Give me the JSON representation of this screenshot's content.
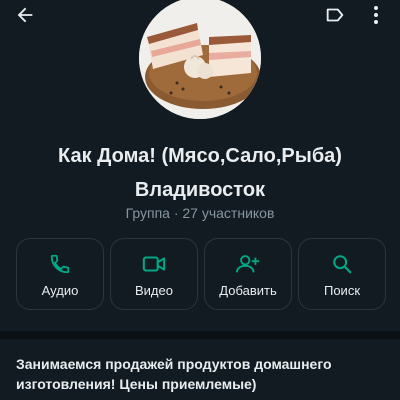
{
  "header": {
    "back_icon": "arrow-left-icon",
    "label_icon": "label-tag-icon",
    "menu_icon": "more-vert-icon"
  },
  "group": {
    "title_line1": "Как Дома! (Мясо,Сало,Рыба)",
    "title_line2": "Владивосток",
    "subtitle": "Группа · 27 участников"
  },
  "actions": [
    {
      "label": "Аудио",
      "icon": "phone-icon"
    },
    {
      "label": "Видео",
      "icon": "video-camera-icon"
    },
    {
      "label": "Добавить",
      "icon": "add-person-icon"
    },
    {
      "label": "Поиск",
      "icon": "search-icon"
    }
  ],
  "description": "Занимаемся продажей продуктов домашнего изготовления! Цены приемлемые)",
  "colors": {
    "background": "#121b22",
    "accent": "#00a884",
    "text": "#e9edef",
    "muted": "#8696a0"
  }
}
